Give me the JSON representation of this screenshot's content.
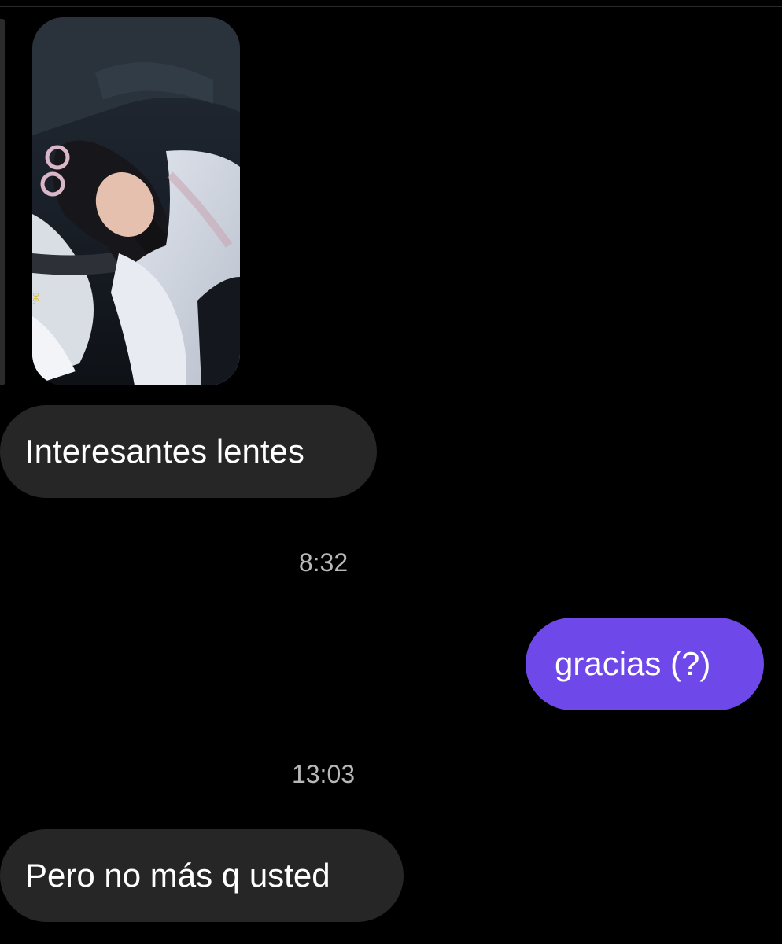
{
  "conversation": {
    "messages": [
      {
        "type": "image",
        "direction": "received",
        "icon": "photo-selfie"
      },
      {
        "type": "text",
        "direction": "received",
        "text": "Interesantes lentes"
      },
      {
        "type": "timestamp",
        "text": "8:32"
      },
      {
        "type": "text",
        "direction": "sent",
        "text": "gracias (?)"
      },
      {
        "type": "timestamp",
        "text": "13:03"
      },
      {
        "type": "text",
        "direction": "received",
        "text": "Pero no más q usted"
      }
    ]
  },
  "colors": {
    "background": "#000000",
    "received_bubble": "#262626",
    "sent_bubble": "#6e48e8",
    "timestamp_text": "#b8b8b8"
  }
}
